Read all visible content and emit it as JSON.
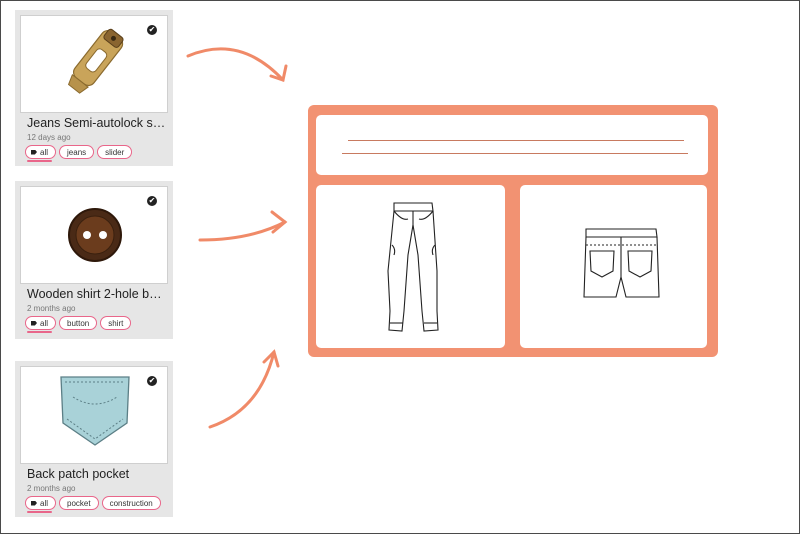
{
  "cards": [
    {
      "title": "Jeans Semi-autolock slid…",
      "time": "12 days ago",
      "icon": "zipper-slider-image",
      "tags": [
        "all",
        "jeans",
        "slider"
      ]
    },
    {
      "title": "Wooden shirt 2-hole butt…",
      "time": "2 months ago",
      "icon": "wooden-button-image",
      "tags": [
        "all",
        "button",
        "shirt"
      ]
    },
    {
      "title": "Back patch pocket",
      "time": "2 months ago",
      "icon": "back-pocket-image",
      "tags": [
        "all",
        "pocket",
        "construction"
      ]
    }
  ],
  "colors": {
    "accent": "#f29272",
    "tag_border": "#e9668a",
    "card_bg": "#e6e6e6"
  },
  "board": {
    "front_view_icon": "jeans-front-sketch",
    "back_view_icon": "jeans-back-sketch"
  }
}
